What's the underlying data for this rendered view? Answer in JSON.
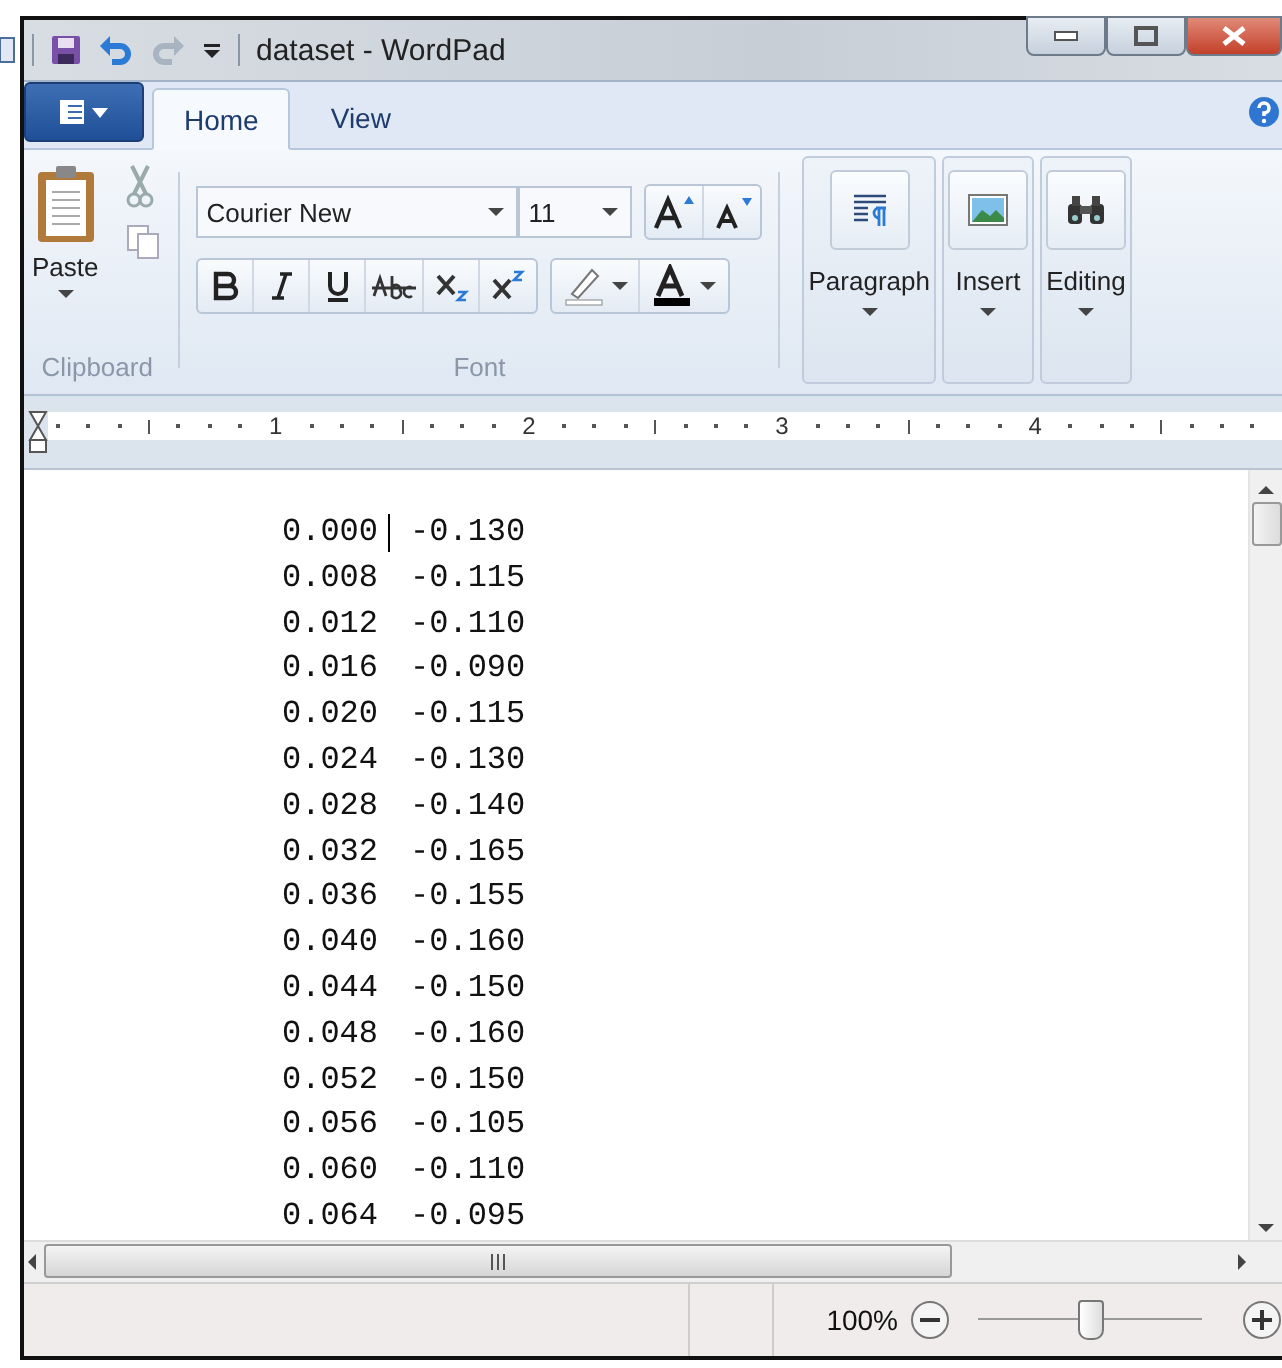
{
  "window": {
    "title": "dataset - WordPad"
  },
  "tabs": [
    {
      "label": "Home",
      "selected": true
    },
    {
      "label": "View",
      "selected": false
    }
  ],
  "ribbon": {
    "groups": [
      {
        "kind": "clipboard",
        "label": "Clipboard",
        "paste": "Paste"
      },
      {
        "kind": "font",
        "label": "Font",
        "font_name": "Courier New",
        "font_size": "11"
      },
      {
        "kind": "paragraph",
        "label": "Paragraph"
      },
      {
        "kind": "insert",
        "label": "Insert"
      },
      {
        "kind": "editing",
        "label": "Editing"
      }
    ]
  },
  "ruler": {
    "marks": [
      "1",
      "2",
      "3",
      "4"
    ]
  },
  "document": {
    "lines": [
      {
        "col_1": "0.000",
        "col_2": "-0.130",
        "cursor": true
      },
      {
        "col_1": "0.008",
        "col_2": "-0.115",
        "cursor": false
      },
      {
        "col_1": "0.012",
        "col_2": "-0.110",
        "cursor": false
      },
      {
        "col_1": "0.016",
        "col_2": "-0.090",
        "cursor": false
      },
      {
        "col_1": "0.020",
        "col_2": "-0.115",
        "cursor": false
      },
      {
        "col_1": "0.024",
        "col_2": "-0.130",
        "cursor": false
      },
      {
        "col_1": "0.028",
        "col_2": "-0.140",
        "cursor": false
      },
      {
        "col_1": "0.032",
        "col_2": "-0.165",
        "cursor": false
      },
      {
        "col_1": "0.036",
        "col_2": "-0.155",
        "cursor": false
      },
      {
        "col_1": "0.040",
        "col_2": "-0.160",
        "cursor": false
      },
      {
        "col_1": "0.044",
        "col_2": "-0.150",
        "cursor": false
      },
      {
        "col_1": "0.048",
        "col_2": "-0.160",
        "cursor": false
      },
      {
        "col_1": "0.052",
        "col_2": "-0.150",
        "cursor": false
      },
      {
        "col_1": "0.056",
        "col_2": "-0.105",
        "cursor": false
      },
      {
        "col_1": "0.060",
        "col_2": "-0.110",
        "cursor": false
      },
      {
        "col_1": "0.064",
        "col_2": "-0.095",
        "cursor": false
      }
    ]
  },
  "status_bar": {
    "zoom": "100%",
    "zoom_slider": {
      "level": 0.5
    }
  }
}
